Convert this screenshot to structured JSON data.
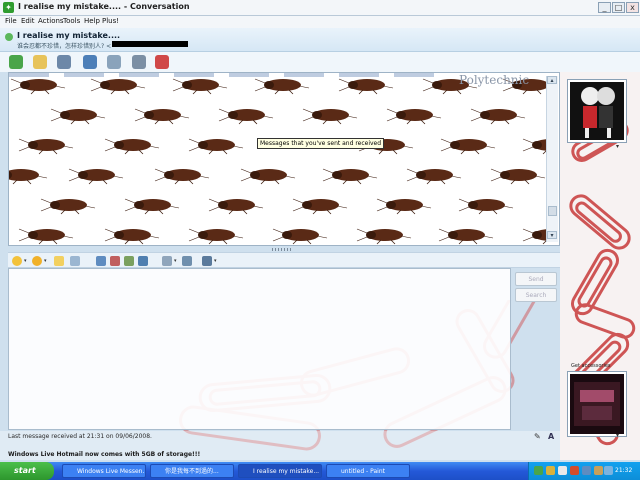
{
  "window": {
    "title": "I  realise my mistake.... - Conversation",
    "minimize": "_",
    "maximize": "□",
    "close": "x"
  },
  "menu": [
    "File",
    "Edit",
    "Actions",
    "Tools",
    "Help",
    "Plus!"
  ],
  "header": {
    "contact_name": "I  realise my mistake....",
    "contact_status": "谁会忍都不珍惜，怎样珍惜别人? <"
  },
  "history": {
    "ghost_text": "Polytechnic",
    "tooltip": "Messages that you've sent and received"
  },
  "actions": {
    "send": "Send",
    "search": "Search"
  },
  "sidebar": {
    "get_accessories": "Get accessories"
  },
  "status": {
    "last_message": "Last message received at 21:31 on 09/06/2008.",
    "ad_text": "Windows Live Hotmail now comes with 5GB of storage!!!"
  },
  "taskbar": {
    "start": "start",
    "tasks": [
      "Windows Live Messen...",
      "你是我每不到過的...",
      "I  realise my mistake...",
      "untitled - Paint"
    ],
    "clock": "21:32"
  },
  "colors": {
    "accent": "#2459d8",
    "start_green": "#2d962d",
    "paperclip_red": "#c83a3a",
    "roach_brown": "#5a2a16"
  },
  "icons": {
    "toolbar": [
      "invite-icon",
      "send-files-icon",
      "video-call-icon",
      "call-icon",
      "activities-icon",
      "games-icon",
      "block-icon"
    ],
    "format": [
      "emoticon-icon",
      "wink-icon",
      "nudge-icon",
      "voice-clip-icon",
      "background-icon",
      "handwriting-icon",
      "font-icon",
      "pencil-icon"
    ]
  }
}
